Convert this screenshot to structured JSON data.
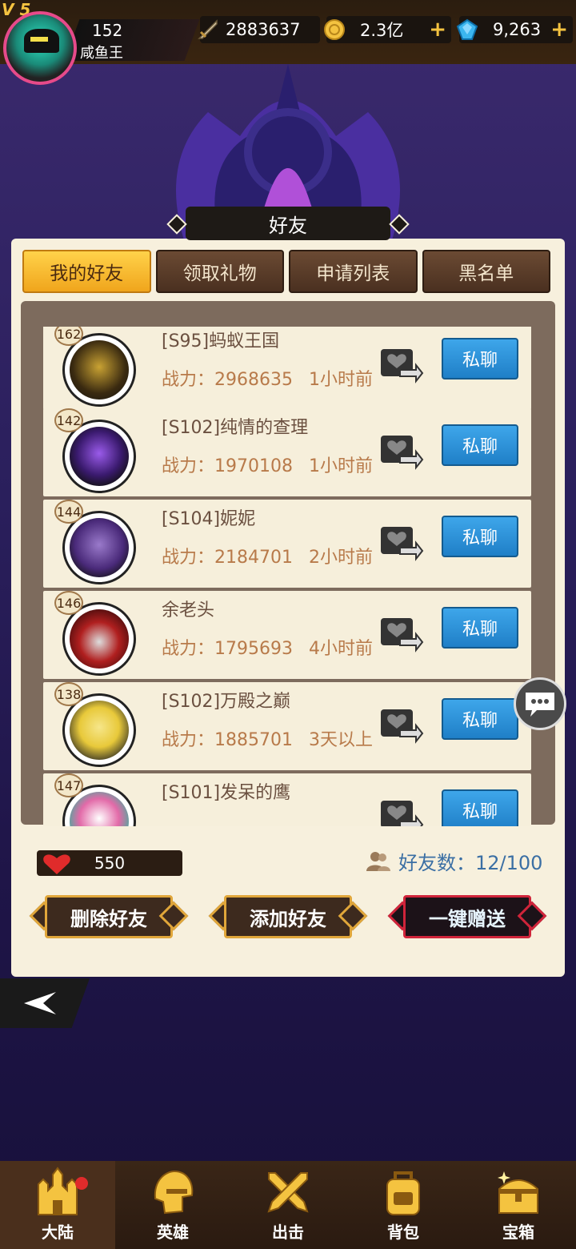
{
  "player": {
    "vip": "V 5",
    "level": "152",
    "name": "咸鱼王"
  },
  "resources": {
    "power": "2883637",
    "gold": "2.3亿",
    "gems": "9,263"
  },
  "title": "好友",
  "tabs": [
    {
      "label": "我的好友",
      "active": true
    },
    {
      "label": "领取礼物",
      "active": false
    },
    {
      "label": "申请列表",
      "active": false
    },
    {
      "label": "黑名单",
      "active": false
    }
  ],
  "friends": [
    {
      "level": "162",
      "name": "[S95]蚂蚁王国",
      "power": "战力：2968635",
      "time": "1小时前",
      "chat": "私聊",
      "color": "#c9a233"
    },
    {
      "level": "142",
      "name": "[S102]纯情的查理",
      "power": "战力：1970108",
      "time": "1小时前",
      "chat": "私聊",
      "color": "#6a3ac7"
    },
    {
      "level": "144",
      "name": "[S104]妮妮",
      "power": "战力：2184701",
      "time": "2小时前",
      "chat": "私聊",
      "color": "#5b3a8a"
    },
    {
      "level": "146",
      "name": "余老头",
      "power": "战力：1795693",
      "time": "4小时前",
      "chat": "私聊",
      "color": "#b01f1f"
    },
    {
      "level": "138",
      "name": "[S102]万殿之巅",
      "power": "战力：1885701",
      "time": "3天以上",
      "chat": "私聊",
      "color": "#e8c93a"
    },
    {
      "level": "147",
      "name": "[S101]发呆的鹰",
      "power": "",
      "time": "",
      "chat": "私聊",
      "color": "#e8e8e8"
    }
  ],
  "hearts": "550",
  "friend_count": "好友数：12/100",
  "buttons": {
    "delete": "删除好友",
    "add": "添加好友",
    "gift_all": "一键赠送"
  },
  "nav": [
    {
      "label": "大陆",
      "icon": "castle-icon",
      "active": true,
      "dot": true
    },
    {
      "label": "英雄",
      "icon": "helmet-icon",
      "active": false,
      "dot": false
    },
    {
      "label": "出击",
      "icon": "crossed-swords-icon",
      "active": false,
      "dot": false
    },
    {
      "label": "背包",
      "icon": "backpack-icon",
      "active": false,
      "dot": false
    },
    {
      "label": "宝箱",
      "icon": "chest-icon",
      "active": false,
      "dot": false
    }
  ]
}
